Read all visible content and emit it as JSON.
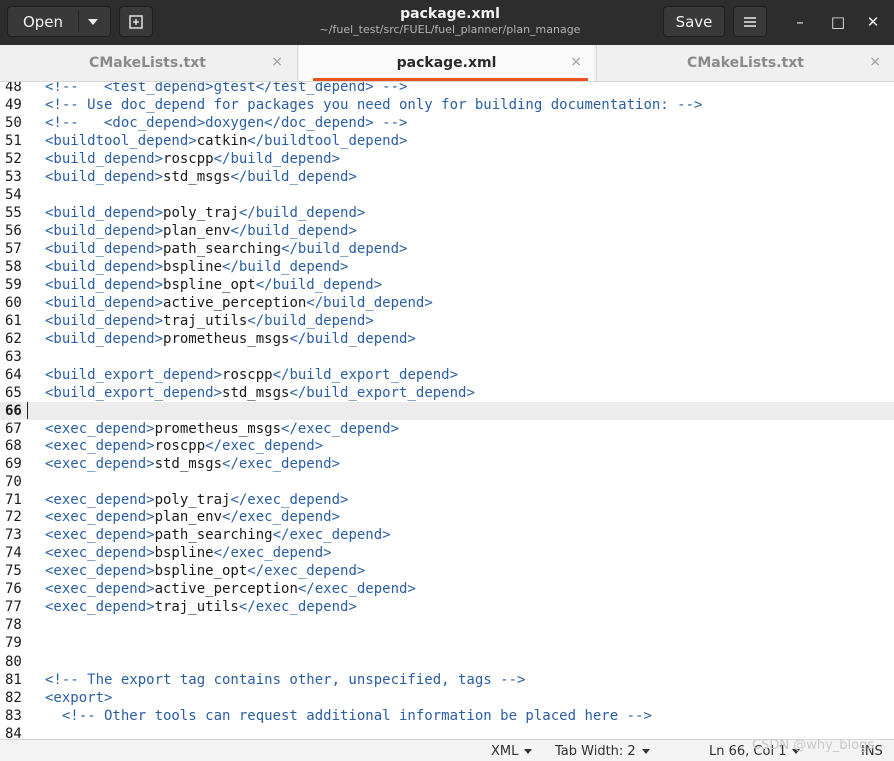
{
  "header": {
    "open_label": "Open",
    "title": "package.xml",
    "subtitle": "~/fuel_test/src/FUEL/fuel_planner/plan_manage",
    "save_label": "Save",
    "menu_icon": "hamburger-icon",
    "newtab_icon": "new-tab-icon",
    "minimize_glyph": "–",
    "maximize_glyph": "□",
    "close_glyph": "✕"
  },
  "tabs": [
    {
      "label": "CMakeLists.txt",
      "active": false
    },
    {
      "label": "package.xml",
      "active": true
    },
    {
      "label": "CMakeLists.txt",
      "active": false
    }
  ],
  "tab_close_glyph": "×",
  "editor": {
    "current_line": 66,
    "lines": [
      {
        "n": "48",
        "tokens": [
          [
            "t-com",
            "<!--   <test_depend>gtest</test_depend> -->"
          ]
        ]
      },
      {
        "n": "49",
        "tokens": [
          [
            "t-com",
            "<!-- Use doc_depend for packages you need only for building documentation: -->"
          ]
        ]
      },
      {
        "n": "50",
        "tokens": [
          [
            "t-com",
            "<!--   <doc_depend>doxygen</doc_depend> -->"
          ]
        ]
      },
      {
        "n": "51",
        "tokens": [
          [
            "t-tag",
            "<buildtool_depend>"
          ],
          [
            "t-txt",
            "catkin"
          ],
          [
            "t-tag",
            "</buildtool_depend>"
          ]
        ]
      },
      {
        "n": "52",
        "tokens": [
          [
            "t-tag",
            "<build_depend>"
          ],
          [
            "t-txt",
            "roscpp"
          ],
          [
            "t-tag",
            "</build_depend>"
          ]
        ]
      },
      {
        "n": "53",
        "tokens": [
          [
            "t-tag",
            "<build_depend>"
          ],
          [
            "t-txt",
            "std_msgs"
          ],
          [
            "t-tag",
            "</build_depend>"
          ]
        ]
      },
      {
        "n": "54",
        "tokens": []
      },
      {
        "n": "55",
        "tokens": [
          [
            "t-tag",
            "<build_depend>"
          ],
          [
            "t-txt",
            "poly_traj"
          ],
          [
            "t-tag",
            "</build_depend>"
          ]
        ]
      },
      {
        "n": "56",
        "tokens": [
          [
            "t-tag",
            "<build_depend>"
          ],
          [
            "t-txt",
            "plan_env"
          ],
          [
            "t-tag",
            "</build_depend>"
          ]
        ]
      },
      {
        "n": "57",
        "tokens": [
          [
            "t-tag",
            "<build_depend>"
          ],
          [
            "t-txt",
            "path_searching"
          ],
          [
            "t-tag",
            "</build_depend>"
          ]
        ]
      },
      {
        "n": "58",
        "tokens": [
          [
            "t-tag",
            "<build_depend>"
          ],
          [
            "t-txt",
            "bspline"
          ],
          [
            "t-tag",
            "</build_depend>"
          ]
        ]
      },
      {
        "n": "59",
        "tokens": [
          [
            "t-tag",
            "<build_depend>"
          ],
          [
            "t-txt",
            "bspline_opt"
          ],
          [
            "t-tag",
            "</build_depend>"
          ]
        ]
      },
      {
        "n": "60",
        "tokens": [
          [
            "t-tag",
            "<build_depend>"
          ],
          [
            "t-txt",
            "active_perception"
          ],
          [
            "t-tag",
            "</build_depend>"
          ]
        ]
      },
      {
        "n": "61",
        "tokens": [
          [
            "t-tag",
            "<build_depend>"
          ],
          [
            "t-txt",
            "traj_utils"
          ],
          [
            "t-tag",
            "</build_depend>"
          ]
        ]
      },
      {
        "n": "62",
        "tokens": [
          [
            "t-tag",
            "<build_depend>"
          ],
          [
            "t-txt",
            "prometheus_msgs"
          ],
          [
            "t-tag",
            "</build_depend>"
          ]
        ]
      },
      {
        "n": "63",
        "tokens": []
      },
      {
        "n": "64",
        "tokens": [
          [
            "t-tag",
            "<build_export_depend>"
          ],
          [
            "t-txt",
            "roscpp"
          ],
          [
            "t-tag",
            "</build_export_depend>"
          ]
        ]
      },
      {
        "n": "65",
        "tokens": [
          [
            "t-tag",
            "<build_export_depend>"
          ],
          [
            "t-txt",
            "std_msgs"
          ],
          [
            "t-tag",
            "</build_export_depend>"
          ]
        ]
      },
      {
        "n": "66",
        "tokens": []
      },
      {
        "n": "67",
        "tokens": [
          [
            "t-tag",
            "<exec_depend>"
          ],
          [
            "t-txt",
            "prometheus_msgs"
          ],
          [
            "t-tag",
            "</exec_depend>"
          ]
        ]
      },
      {
        "n": "68",
        "tokens": [
          [
            "t-tag",
            "<exec_depend>"
          ],
          [
            "t-txt",
            "roscpp"
          ],
          [
            "t-tag",
            "</exec_depend>"
          ]
        ]
      },
      {
        "n": "69",
        "tokens": [
          [
            "t-tag",
            "<exec_depend>"
          ],
          [
            "t-txt",
            "std_msgs"
          ],
          [
            "t-tag",
            "</exec_depend>"
          ]
        ]
      },
      {
        "n": "70",
        "tokens": []
      },
      {
        "n": "71",
        "tokens": [
          [
            "t-tag",
            "<exec_depend>"
          ],
          [
            "t-txt",
            "poly_traj"
          ],
          [
            "t-tag",
            "</exec_depend>"
          ]
        ]
      },
      {
        "n": "72",
        "tokens": [
          [
            "t-tag",
            "<exec_depend>"
          ],
          [
            "t-txt",
            "plan_env"
          ],
          [
            "t-tag",
            "</exec_depend>"
          ]
        ]
      },
      {
        "n": "73",
        "tokens": [
          [
            "t-tag",
            "<exec_depend>"
          ],
          [
            "t-txt",
            "path_searching"
          ],
          [
            "t-tag",
            "</exec_depend>"
          ]
        ]
      },
      {
        "n": "74",
        "tokens": [
          [
            "t-tag",
            "<exec_depend>"
          ],
          [
            "t-txt",
            "bspline"
          ],
          [
            "t-tag",
            "</exec_depend>"
          ]
        ]
      },
      {
        "n": "75",
        "tokens": [
          [
            "t-tag",
            "<exec_depend>"
          ],
          [
            "t-txt",
            "bspline_opt"
          ],
          [
            "t-tag",
            "</exec_depend>"
          ]
        ]
      },
      {
        "n": "76",
        "tokens": [
          [
            "t-tag",
            "<exec_depend>"
          ],
          [
            "t-txt",
            "active_perception"
          ],
          [
            "t-tag",
            "</exec_depend>"
          ]
        ]
      },
      {
        "n": "77",
        "tokens": [
          [
            "t-tag",
            "<exec_depend>"
          ],
          [
            "t-txt",
            "traj_utils"
          ],
          [
            "t-tag",
            "</exec_depend>"
          ]
        ]
      },
      {
        "n": "78",
        "tokens": []
      },
      {
        "n": "79",
        "tokens": []
      },
      {
        "n": "80",
        "tokens": []
      },
      {
        "n": "81",
        "tokens": [
          [
            "t-com",
            "<!-- The export tag contains other, unspecified, tags -->"
          ]
        ]
      },
      {
        "n": "82",
        "tokens": [
          [
            "t-tag",
            "<export>"
          ]
        ]
      },
      {
        "n": "83",
        "tokens": [
          [
            "t-com",
            "  <!-- Other tools can request additional information be placed here -->"
          ]
        ]
      },
      {
        "n": "84",
        "tokens": []
      }
    ]
  },
  "statusbar": {
    "language": "XML",
    "tab_width": "Tab Width: 2",
    "position": "Ln 66, Col 1",
    "mode": "INS"
  },
  "watermark": "CSDN @why_blogs"
}
